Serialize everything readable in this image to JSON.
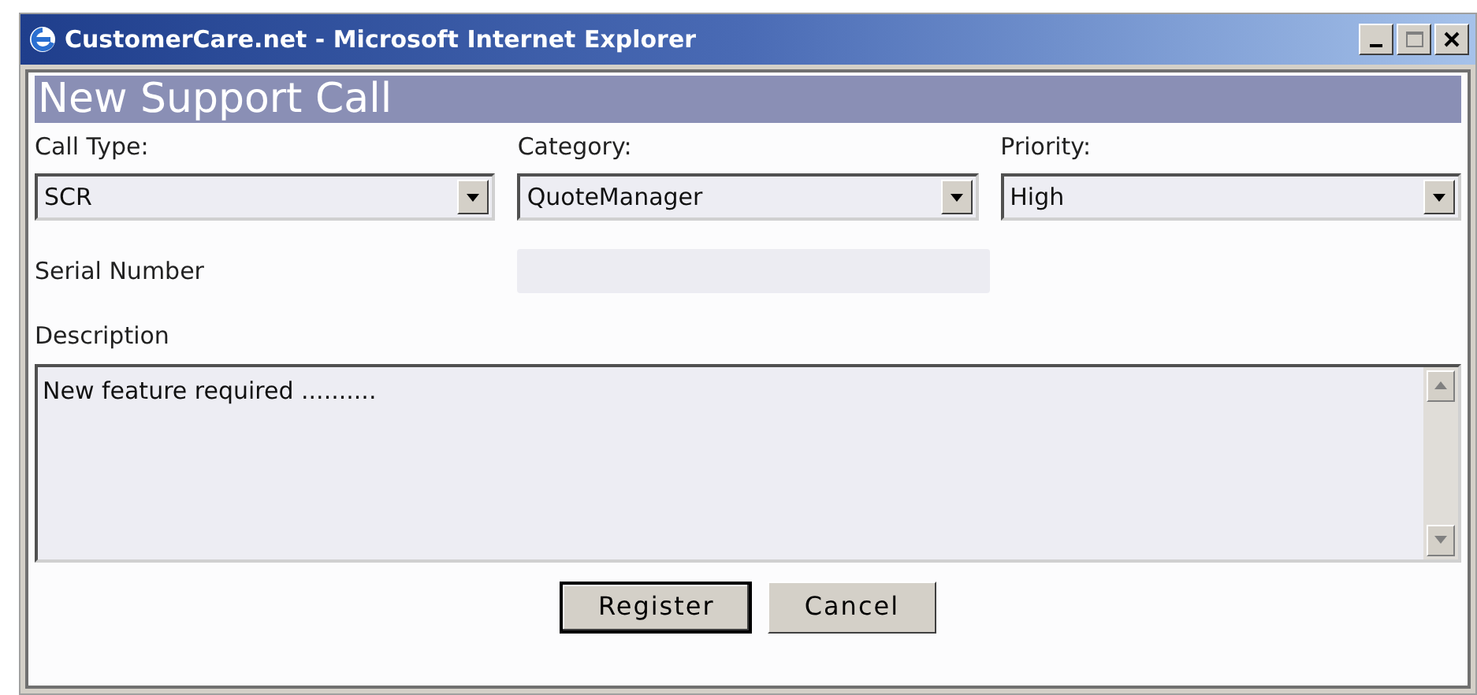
{
  "window": {
    "title": "CustomerCare.net - Microsoft Internet Explorer"
  },
  "heading": "New Support Call",
  "selects": [
    {
      "label": "Call Type:",
      "value": "SCR"
    },
    {
      "label": "Category:",
      "value": "QuoteManager"
    },
    {
      "label": "Priority:",
      "value": "High"
    }
  ],
  "serial_number": {
    "label": "Serial Number"
  },
  "description": {
    "label": "Description",
    "value": "New feature required .........."
  },
  "buttons": [
    {
      "label": "Register",
      "default": true
    },
    {
      "label": "Cancel",
      "default": false
    }
  ]
}
